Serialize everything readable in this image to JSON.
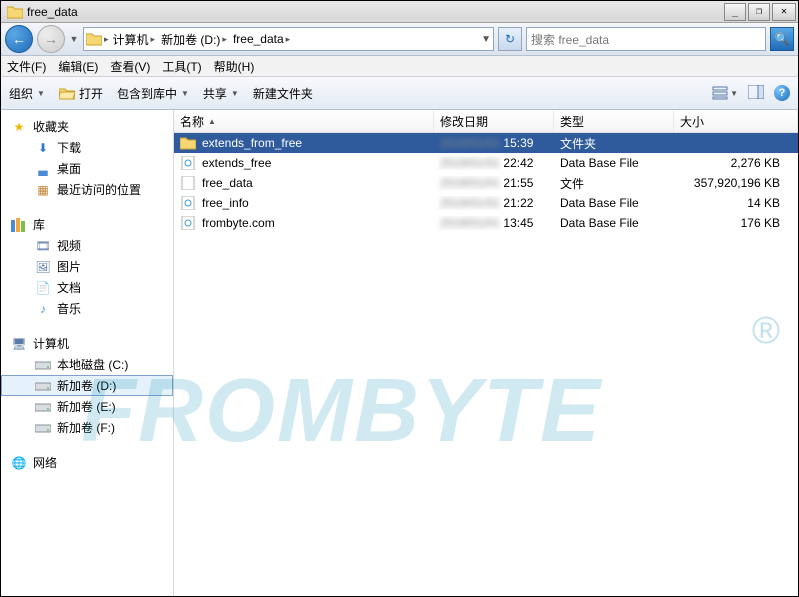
{
  "window": {
    "title": "free_data"
  },
  "winbtns": {
    "min": "_",
    "max": "❐",
    "close": "✕"
  },
  "nav": {
    "crumbs": [
      "计算机",
      "新加卷 (D:)",
      "free_data"
    ],
    "search_placeholder": "搜索 free_data"
  },
  "menu": {
    "file": "文件(F)",
    "edit": "编辑(E)",
    "view": "查看(V)",
    "tools": "工具(T)",
    "help": "帮助(H)"
  },
  "toolbar": {
    "organize": "组织",
    "open": "打开",
    "include": "包含到库中",
    "share": "共享",
    "newfolder": "新建文件夹"
  },
  "sidebar": {
    "fav": "收藏夹",
    "fav_items": [
      "下载",
      "桌面",
      "最近访问的位置"
    ],
    "lib": "库",
    "lib_items": [
      "视频",
      "图片",
      "文档",
      "音乐"
    ],
    "computer": "计算机",
    "drives": [
      "本地磁盘 (C:)",
      "新加卷 (D:)",
      "新加卷 (E:)",
      "新加卷 (F:)"
    ],
    "network": "网络"
  },
  "columns": {
    "name": "名称",
    "date": "修改日期",
    "type": "类型",
    "size": "大小"
  },
  "rows": [
    {
      "name": "extends_from_free",
      "kind": "folder",
      "time": "15:39",
      "type": "文件夹",
      "size": "",
      "selected": true
    },
    {
      "name": "extends_free",
      "kind": "db",
      "time": "22:42",
      "type": "Data Base File",
      "size": "2,276 KB"
    },
    {
      "name": "free_data",
      "kind": "file",
      "time": "21:55",
      "type": "文件",
      "size": "357,920,196 KB"
    },
    {
      "name": "free_info",
      "kind": "db",
      "time": "21:22",
      "type": "Data Base File",
      "size": "14 KB"
    },
    {
      "name": "frombyte.com",
      "kind": "db",
      "time": "13:45",
      "type": "Data Base File",
      "size": "176 KB"
    }
  ],
  "watermark": "FROMBYTE"
}
